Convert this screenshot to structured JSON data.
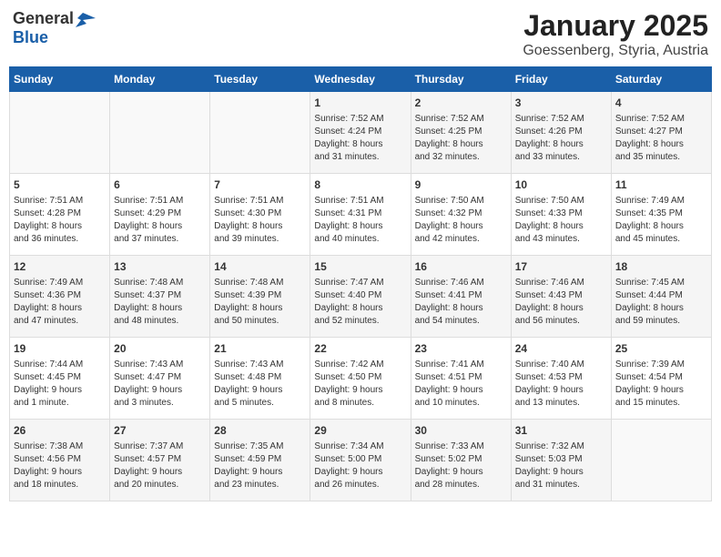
{
  "header": {
    "logo_line1": "General",
    "logo_line2": "Blue",
    "main_title": "January 2025",
    "sub_title": "Goessenberg, Styria, Austria"
  },
  "days_of_week": [
    "Sunday",
    "Monday",
    "Tuesday",
    "Wednesday",
    "Thursday",
    "Friday",
    "Saturday"
  ],
  "weeks": [
    [
      {
        "day": "",
        "info": ""
      },
      {
        "day": "",
        "info": ""
      },
      {
        "day": "",
        "info": ""
      },
      {
        "day": "1",
        "info": "Sunrise: 7:52 AM\nSunset: 4:24 PM\nDaylight: 8 hours\nand 31 minutes."
      },
      {
        "day": "2",
        "info": "Sunrise: 7:52 AM\nSunset: 4:25 PM\nDaylight: 8 hours\nand 32 minutes."
      },
      {
        "day": "3",
        "info": "Sunrise: 7:52 AM\nSunset: 4:26 PM\nDaylight: 8 hours\nand 33 minutes."
      },
      {
        "day": "4",
        "info": "Sunrise: 7:52 AM\nSunset: 4:27 PM\nDaylight: 8 hours\nand 35 minutes."
      }
    ],
    [
      {
        "day": "5",
        "info": "Sunrise: 7:51 AM\nSunset: 4:28 PM\nDaylight: 8 hours\nand 36 minutes."
      },
      {
        "day": "6",
        "info": "Sunrise: 7:51 AM\nSunset: 4:29 PM\nDaylight: 8 hours\nand 37 minutes."
      },
      {
        "day": "7",
        "info": "Sunrise: 7:51 AM\nSunset: 4:30 PM\nDaylight: 8 hours\nand 39 minutes."
      },
      {
        "day": "8",
        "info": "Sunrise: 7:51 AM\nSunset: 4:31 PM\nDaylight: 8 hours\nand 40 minutes."
      },
      {
        "day": "9",
        "info": "Sunrise: 7:50 AM\nSunset: 4:32 PM\nDaylight: 8 hours\nand 42 minutes."
      },
      {
        "day": "10",
        "info": "Sunrise: 7:50 AM\nSunset: 4:33 PM\nDaylight: 8 hours\nand 43 minutes."
      },
      {
        "day": "11",
        "info": "Sunrise: 7:49 AM\nSunset: 4:35 PM\nDaylight: 8 hours\nand 45 minutes."
      }
    ],
    [
      {
        "day": "12",
        "info": "Sunrise: 7:49 AM\nSunset: 4:36 PM\nDaylight: 8 hours\nand 47 minutes."
      },
      {
        "day": "13",
        "info": "Sunrise: 7:48 AM\nSunset: 4:37 PM\nDaylight: 8 hours\nand 48 minutes."
      },
      {
        "day": "14",
        "info": "Sunrise: 7:48 AM\nSunset: 4:39 PM\nDaylight: 8 hours\nand 50 minutes."
      },
      {
        "day": "15",
        "info": "Sunrise: 7:47 AM\nSunset: 4:40 PM\nDaylight: 8 hours\nand 52 minutes."
      },
      {
        "day": "16",
        "info": "Sunrise: 7:46 AM\nSunset: 4:41 PM\nDaylight: 8 hours\nand 54 minutes."
      },
      {
        "day": "17",
        "info": "Sunrise: 7:46 AM\nSunset: 4:43 PM\nDaylight: 8 hours\nand 56 minutes."
      },
      {
        "day": "18",
        "info": "Sunrise: 7:45 AM\nSunset: 4:44 PM\nDaylight: 8 hours\nand 59 minutes."
      }
    ],
    [
      {
        "day": "19",
        "info": "Sunrise: 7:44 AM\nSunset: 4:45 PM\nDaylight: 9 hours\nand 1 minute."
      },
      {
        "day": "20",
        "info": "Sunrise: 7:43 AM\nSunset: 4:47 PM\nDaylight: 9 hours\nand 3 minutes."
      },
      {
        "day": "21",
        "info": "Sunrise: 7:43 AM\nSunset: 4:48 PM\nDaylight: 9 hours\nand 5 minutes."
      },
      {
        "day": "22",
        "info": "Sunrise: 7:42 AM\nSunset: 4:50 PM\nDaylight: 9 hours\nand 8 minutes."
      },
      {
        "day": "23",
        "info": "Sunrise: 7:41 AM\nSunset: 4:51 PM\nDaylight: 9 hours\nand 10 minutes."
      },
      {
        "day": "24",
        "info": "Sunrise: 7:40 AM\nSunset: 4:53 PM\nDaylight: 9 hours\nand 13 minutes."
      },
      {
        "day": "25",
        "info": "Sunrise: 7:39 AM\nSunset: 4:54 PM\nDaylight: 9 hours\nand 15 minutes."
      }
    ],
    [
      {
        "day": "26",
        "info": "Sunrise: 7:38 AM\nSunset: 4:56 PM\nDaylight: 9 hours\nand 18 minutes."
      },
      {
        "day": "27",
        "info": "Sunrise: 7:37 AM\nSunset: 4:57 PM\nDaylight: 9 hours\nand 20 minutes."
      },
      {
        "day": "28",
        "info": "Sunrise: 7:35 AM\nSunset: 4:59 PM\nDaylight: 9 hours\nand 23 minutes."
      },
      {
        "day": "29",
        "info": "Sunrise: 7:34 AM\nSunset: 5:00 PM\nDaylight: 9 hours\nand 26 minutes."
      },
      {
        "day": "30",
        "info": "Sunrise: 7:33 AM\nSunset: 5:02 PM\nDaylight: 9 hours\nand 28 minutes."
      },
      {
        "day": "31",
        "info": "Sunrise: 7:32 AM\nSunset: 5:03 PM\nDaylight: 9 hours\nand 31 minutes."
      },
      {
        "day": "",
        "info": ""
      }
    ]
  ]
}
